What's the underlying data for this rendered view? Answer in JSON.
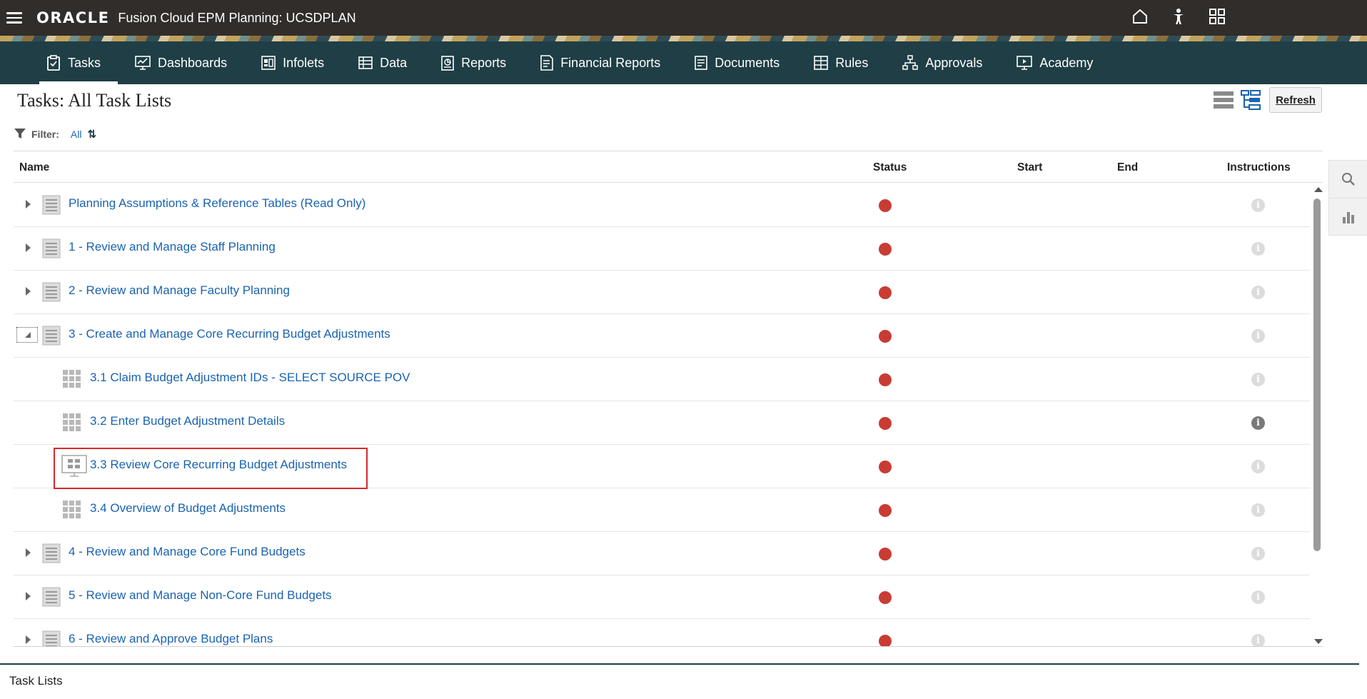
{
  "app": {
    "brand": "ORACLE",
    "title": "Fusion Cloud EPM Planning:  UCSDPLAN"
  },
  "top_icons": [
    "home-icon",
    "accessibility-icon",
    "navigator-grid-icon"
  ],
  "nav": {
    "items": [
      {
        "label": "Tasks",
        "icon": "clipboard-icon",
        "active": true
      },
      {
        "label": "Dashboards",
        "icon": "dashboard-icon",
        "active": false
      },
      {
        "label": "Infolets",
        "icon": "infolet-icon",
        "active": false
      },
      {
        "label": "Data",
        "icon": "data-form-icon",
        "active": false
      },
      {
        "label": "Reports",
        "icon": "report-icon",
        "active": false
      },
      {
        "label": "Financial Reports",
        "icon": "financial-report-icon",
        "active": false
      },
      {
        "label": "Documents",
        "icon": "document-icon",
        "active": false
      },
      {
        "label": "Rules",
        "icon": "rules-icon",
        "active": false
      },
      {
        "label": "Approvals",
        "icon": "approvals-icon",
        "active": false
      },
      {
        "label": "Academy",
        "icon": "academy-icon",
        "active": false
      }
    ]
  },
  "page": {
    "title": "Tasks: All Task Lists",
    "refresh_label": "Refresh",
    "filter_label": "Filter:",
    "filter_value": "All"
  },
  "table": {
    "columns": {
      "name": "Name",
      "status": "Status",
      "start": "Start",
      "end": "End",
      "instructions": "Instructions"
    },
    "rows": [
      {
        "name": "Planning Assumptions & Reference Tables (Read Only)",
        "level": 0,
        "type": "task-list",
        "expander": "collapsed",
        "status": "red",
        "info": "light"
      },
      {
        "name": "1 - Review and Manage Staff Planning",
        "level": 0,
        "type": "task-list",
        "expander": "collapsed",
        "status": "red",
        "info": "light"
      },
      {
        "name": "2 - Review and Manage Faculty Planning",
        "level": 0,
        "type": "task-list",
        "expander": "collapsed",
        "status": "red",
        "info": "light"
      },
      {
        "name": "3 - Create and Manage Core Recurring Budget Adjustments",
        "level": 0,
        "type": "task-list",
        "expander": "open",
        "status": "red",
        "info": "light"
      },
      {
        "name": "3.1 Claim Budget Adjustment IDs - SELECT SOURCE POV",
        "level": 1,
        "type": "form",
        "expander": "none",
        "status": "red",
        "info": "light"
      },
      {
        "name": "3.2 Enter Budget Adjustment Details",
        "level": 1,
        "type": "form",
        "expander": "none",
        "status": "red",
        "info": "dark"
      },
      {
        "name": "3.3 Review Core Recurring Budget Adjustments",
        "level": 1,
        "type": "dashboard",
        "expander": "none",
        "status": "red",
        "info": "light",
        "highlighted": true
      },
      {
        "name": "3.4 Overview of Budget Adjustments",
        "level": 1,
        "type": "form",
        "expander": "none",
        "status": "red",
        "info": "light"
      },
      {
        "name": "4 - Review and Manage Core Fund Budgets",
        "level": 0,
        "type": "task-list",
        "expander": "collapsed",
        "status": "red",
        "info": "light"
      },
      {
        "name": "5 - Review and Manage Non-Core Fund Budgets",
        "level": 0,
        "type": "task-list",
        "expander": "collapsed",
        "status": "red",
        "info": "light"
      },
      {
        "name": "6 - Review and Approve Budget Plans",
        "level": 0,
        "type": "task-list",
        "expander": "collapsed",
        "status": "red",
        "info": "light"
      }
    ]
  },
  "side_panel": [
    "search-icon",
    "chart-icon"
  ],
  "bottom": {
    "tab_label": "Task Lists"
  },
  "colors": {
    "topbar": "#312d2a",
    "nav": "#1f3e46",
    "link": "#1a63b0",
    "status_red": "#c83c34",
    "highlight": "#d9272e"
  }
}
